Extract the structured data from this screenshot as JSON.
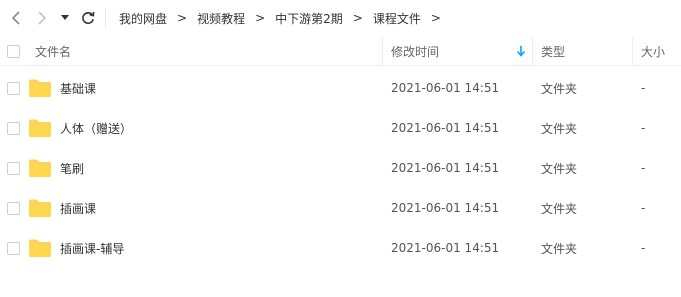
{
  "breadcrumb": [
    "我的网盘",
    "视频教程",
    "中下游第2期",
    "课程文件"
  ],
  "breadcrumb_separator": ">",
  "columns": {
    "name": "文件名",
    "modified": "修改时间",
    "type": "类型",
    "size": "大小"
  },
  "sort": {
    "column": "modified",
    "direction": "descending"
  },
  "accent_color": "#06a7ff",
  "folder_color": "#fdd45b",
  "rows": [
    {
      "name": "基础课",
      "modified": "2021-06-01 14:51",
      "type": "文件夹",
      "size": "-"
    },
    {
      "name": "人体（赠送）",
      "modified": "2021-06-01 14:51",
      "type": "文件夹",
      "size": "-"
    },
    {
      "name": "笔刷",
      "modified": "2021-06-01 14:51",
      "type": "文件夹",
      "size": "-"
    },
    {
      "name": "插画课",
      "modified": "2021-06-01 14:51",
      "type": "文件夹",
      "size": "-"
    },
    {
      "name": "插画课-辅导",
      "modified": "2021-06-01 14:51",
      "type": "文件夹",
      "size": "-"
    }
  ]
}
